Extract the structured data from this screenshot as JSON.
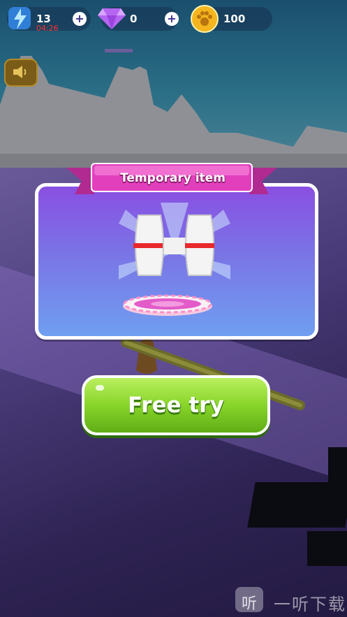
{
  "hud": {
    "energy": "13",
    "energy_timer": "04:26",
    "gems": "0",
    "coins": "100",
    "plus_symbol": "+"
  },
  "popup": {
    "title": "Temporary item",
    "item": "magnet-barbell"
  },
  "actions": {
    "free_try_label": "Free try"
  },
  "watermark": {
    "logo_glyph": "听",
    "text": "一听下载"
  },
  "colors": {
    "button_green": "#88d52a",
    "ribbon_pink": "#e23fbd",
    "panel_purple": "#8a4fe2",
    "timer_red": "#ff2f2f"
  }
}
